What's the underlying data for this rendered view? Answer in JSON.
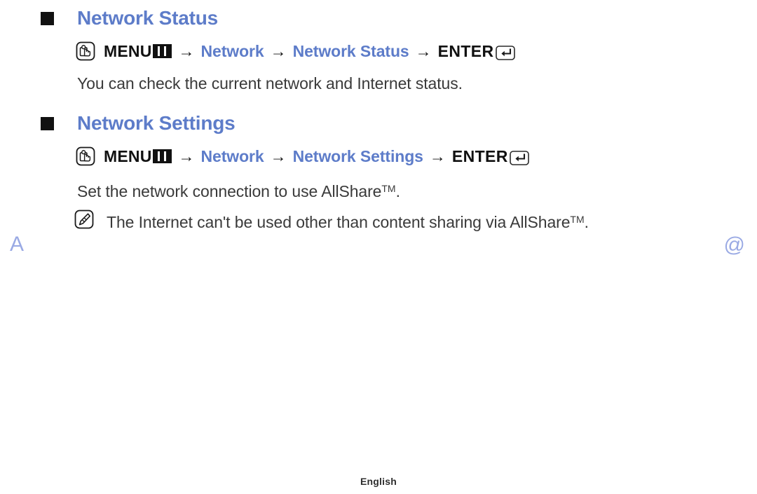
{
  "page": {
    "language_footer": "English",
    "margin_marks": {
      "left_letter": "A",
      "right_symbol": "@"
    },
    "colors": {
      "heading_blue": "#5d7cc9",
      "path_blue": "#5d7cc9",
      "body_text": "#3a3a3a",
      "bullet": "#111111",
      "margin_mark": "#9aaae4",
      "background": "#ffffff"
    }
  },
  "sections": [
    {
      "id": "network-status",
      "heading": "Network Status",
      "bullet_icon": "filled-square-bullet-icon",
      "path": {
        "lead_icon": "touch-hand-icon",
        "menu_label": "MENU",
        "menu_glyph_icon": "menu-bars-glyph-icon",
        "arrow": "→",
        "steps": [
          "Network",
          "Network Status"
        ],
        "enter_label": "ENTER",
        "enter_glyph_icon": "enter-return-key-icon"
      },
      "body": "You can check the current network and Internet status.",
      "note": null
    },
    {
      "id": "network-settings",
      "heading": "Network Settings",
      "bullet_icon": "filled-square-bullet-icon",
      "path": {
        "lead_icon": "touch-hand-icon",
        "menu_label": "MENU",
        "menu_glyph_icon": "menu-bars-glyph-icon",
        "arrow": "→",
        "steps": [
          "Network",
          "Network Settings"
        ],
        "enter_label": "ENTER",
        "enter_glyph_icon": "enter-return-key-icon"
      },
      "body_prefix": "Set the network connection to use AllShare",
      "body_tm": "TM",
      "body_suffix": ".",
      "note": {
        "icon": "note-pencil-icon",
        "prefix": "The Internet can't be used other than content sharing via AllShare",
        "tm": "TM",
        "suffix": "."
      }
    }
  ]
}
